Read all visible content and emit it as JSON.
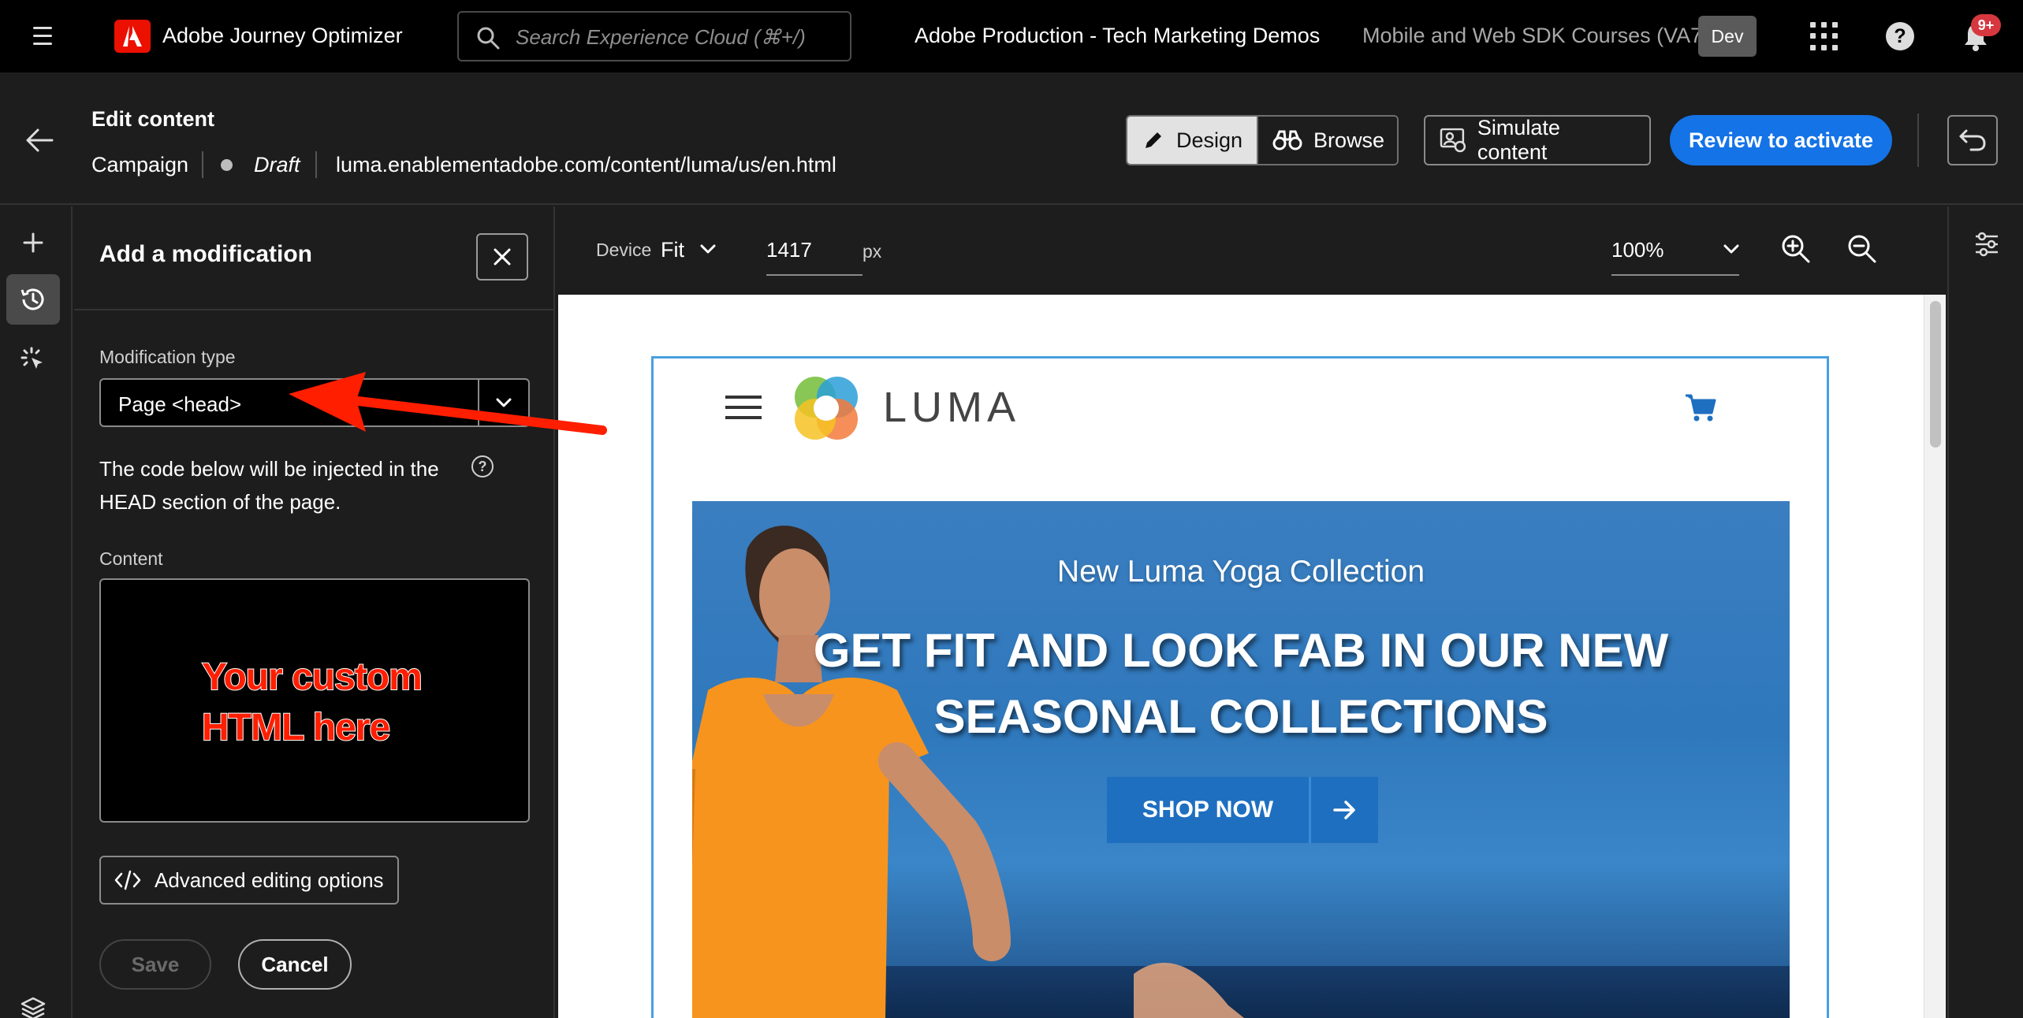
{
  "topnav": {
    "app_title": "Adobe Journey Optimizer",
    "search_placeholder": "Search Experience Cloud (⌘+/)",
    "org_name": "Adobe Production - Tech Marketing Demos",
    "sandbox_name": "Mobile and Web SDK Courses (VA7)",
    "env_badge": "Dev",
    "notification_count": "9+"
  },
  "header": {
    "title": "Edit content",
    "type": "Campaign",
    "status": "Draft",
    "url": "luma.enablementadobe.com/content/luma/us/en.html",
    "mode_design": "Design",
    "mode_browse": "Browse",
    "simulate": "Simulate content",
    "review": "Review to activate"
  },
  "panel": {
    "title": "Add a modification",
    "modification_type_label": "Modification type",
    "modification_type_value": "Page <head>",
    "hint": "The code below will be injected in the HEAD section of the page.",
    "content_label": "Content",
    "annotation": "Your custom HTML here",
    "advanced_label": "Advanced editing options",
    "save_label": "Save",
    "cancel_label": "Cancel"
  },
  "toolbar": {
    "device_label": "Device",
    "device_value": "Fit",
    "width_value": "1417",
    "width_unit": "px",
    "zoom_value": "100%"
  },
  "preview": {
    "brand": "LUMA",
    "eyebrow": "New Luma Yoga Collection",
    "headline": "GET FIT AND LOOK FAB IN OUR NEW SEASONAL COLLECTIONS",
    "cta": "SHOP NOW"
  },
  "colors": {
    "accent": "#1473e6",
    "adobe_red": "#eb1000",
    "annotation_red": "#ff1e00",
    "selection_blue": "#4a9fe0"
  }
}
